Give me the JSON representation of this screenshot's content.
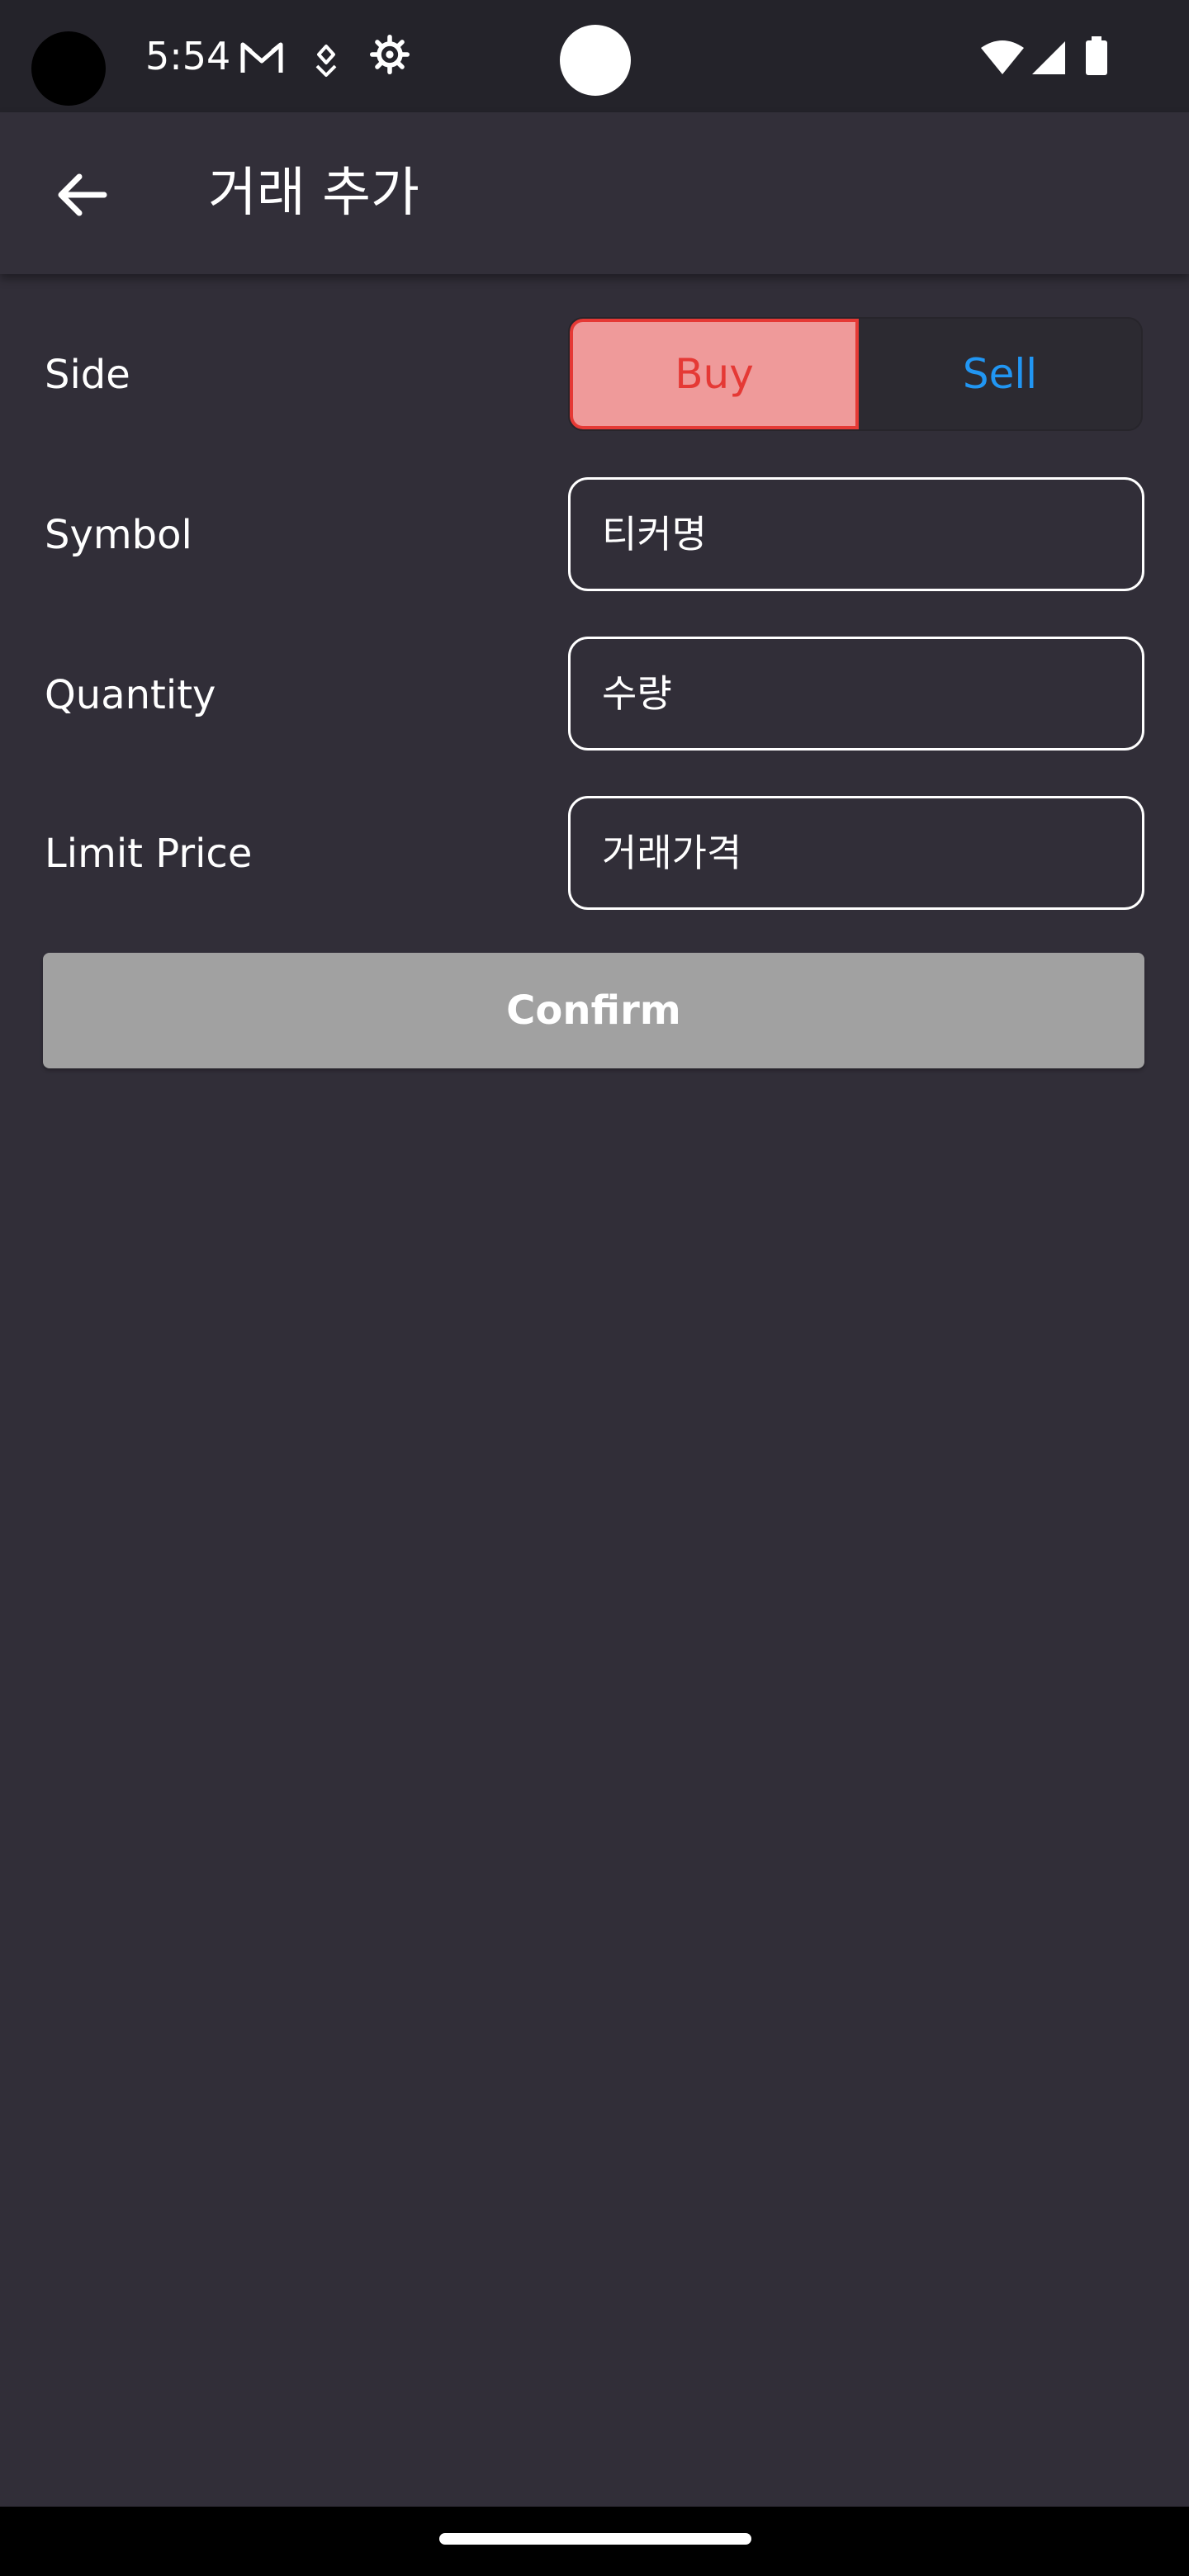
{
  "status_bar": {
    "time": "5:54",
    "left_icons": [
      "gmail-icon",
      "location-arrows-icon",
      "settings-gear-icon"
    ],
    "right_icons": [
      "wifi-icon",
      "cellular-signal-icon",
      "battery-icon"
    ]
  },
  "app_bar": {
    "back_icon": "arrow-left-icon",
    "title": "거래 추가"
  },
  "form": {
    "side": {
      "label": "Side",
      "options": [
        {
          "label": "Buy",
          "selected": true
        },
        {
          "label": "Sell",
          "selected": false
        }
      ]
    },
    "symbol": {
      "label": "Symbol",
      "placeholder": "티커명",
      "value": ""
    },
    "quantity": {
      "label": "Quantity",
      "placeholder": "수량",
      "value": ""
    },
    "limit_price": {
      "label": "Limit Price",
      "placeholder": "거래가격",
      "value": ""
    },
    "confirm_label": "Confirm"
  },
  "colors": {
    "background": "#312E38",
    "status_bar": "#24232A",
    "buy_fill": "#EF9A9A",
    "buy_accent": "#E53935",
    "sell_accent": "#2196F3",
    "confirm_disabled": "#A1A1A1"
  }
}
